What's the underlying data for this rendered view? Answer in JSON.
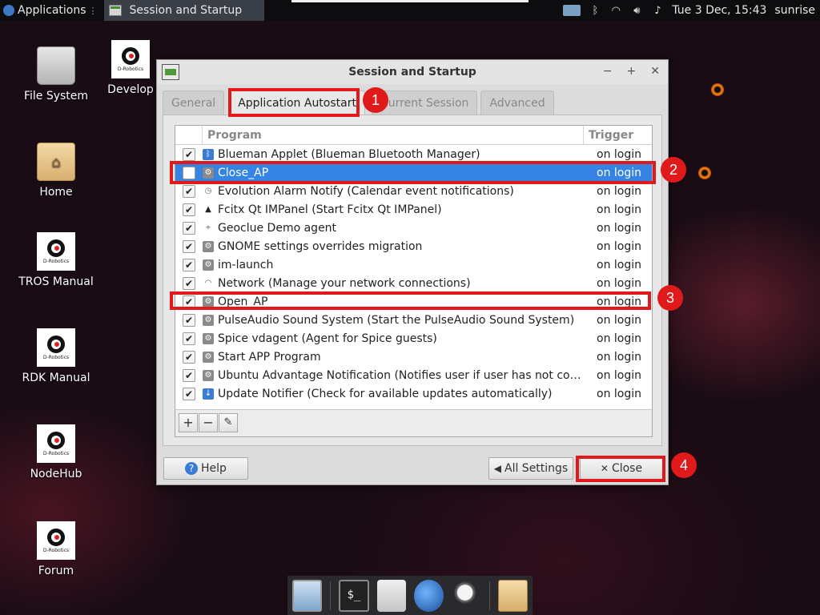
{
  "top_panel": {
    "applications_label": "Applications",
    "task_button_label": "Session and Startup",
    "clock": "Tue  3 Dec, 15:43",
    "user": "sunrise"
  },
  "desktop_icons": [
    {
      "label": "File System",
      "icon": "drive-icon"
    },
    {
      "label": "Develop",
      "icon": "d-robotics-icon"
    },
    {
      "label": "Home",
      "icon": "home-folder-icon"
    },
    {
      "label": "TROS Manual",
      "icon": "d-robotics-icon"
    },
    {
      "label": "RDK Manual",
      "icon": "d-robotics-icon"
    },
    {
      "label": "NodeHub",
      "icon": "d-robotics-icon"
    },
    {
      "label": "Forum",
      "icon": "d-robotics-icon"
    }
  ],
  "d_robotics_logo_text": "D-Robotics",
  "window": {
    "title": "Session and Startup",
    "tabs": [
      {
        "label": "General",
        "active": false
      },
      {
        "label": "Application Autostart",
        "active": true
      },
      {
        "label": "Current Session",
        "active": false
      },
      {
        "label": "Advanced",
        "active": false
      }
    ],
    "columns": {
      "program": "Program",
      "trigger": "Trigger"
    },
    "rows": [
      {
        "checked": true,
        "icon": "bluetooth-icon",
        "name": "Blueman Applet (Blueman Bluetooth Manager)",
        "trigger": "on login",
        "selected": false
      },
      {
        "checked": false,
        "icon": "gear-icon",
        "name": "Close_AP",
        "trigger": "on login",
        "selected": true
      },
      {
        "checked": true,
        "icon": "clock-icon",
        "name": "Evolution Alarm Notify (Calendar event notifications)",
        "trigger": "on login",
        "selected": false
      },
      {
        "checked": true,
        "icon": "penguin-icon",
        "name": "Fcitx Qt IMPanel (Start Fcitx Qt IMPanel)",
        "trigger": "on login",
        "selected": false
      },
      {
        "checked": true,
        "icon": "location-pin-icon",
        "name": "Geoclue Demo agent",
        "trigger": "on login",
        "selected": false
      },
      {
        "checked": true,
        "icon": "gear-icon",
        "name": "GNOME settings overrides migration",
        "trigger": "on login",
        "selected": false
      },
      {
        "checked": true,
        "icon": "gear-icon",
        "name": "im-launch",
        "trigger": "on login",
        "selected": false
      },
      {
        "checked": true,
        "icon": "wifi-icon",
        "name": "Network (Manage your network connections)",
        "trigger": "on login",
        "selected": false
      },
      {
        "checked": true,
        "icon": "gear-icon",
        "name": "Open_AP",
        "trigger": "on login",
        "selected": false
      },
      {
        "checked": true,
        "icon": "gear-icon",
        "name": "PulseAudio Sound System (Start the PulseAudio Sound System)",
        "trigger": "on login",
        "selected": false
      },
      {
        "checked": true,
        "icon": "gear-icon",
        "name": "Spice vdagent (Agent for Spice guests)",
        "trigger": "on login",
        "selected": false
      },
      {
        "checked": true,
        "icon": "gear-icon",
        "name": "Start APP Program",
        "trigger": "on login",
        "selected": false
      },
      {
        "checked": true,
        "icon": "gear-icon",
        "name": "Ubuntu Advantage Notification (Notifies user if user has not connec…",
        "trigger": "on login",
        "selected": false
      },
      {
        "checked": true,
        "icon": "download-icon",
        "name": "Update Notifier (Check for available updates automatically)",
        "trigger": "on login",
        "selected": false
      }
    ],
    "tools": {
      "add": "+",
      "remove": "−",
      "edit": "✎"
    },
    "footer": {
      "help": "Help",
      "all_settings": "All Settings",
      "close": "Close"
    }
  },
  "annotations": [
    "1",
    "2",
    "3",
    "4"
  ],
  "colors": {
    "highlight": "#e01a1a",
    "selection": "#3584e4",
    "panel": "#0d0d10"
  }
}
